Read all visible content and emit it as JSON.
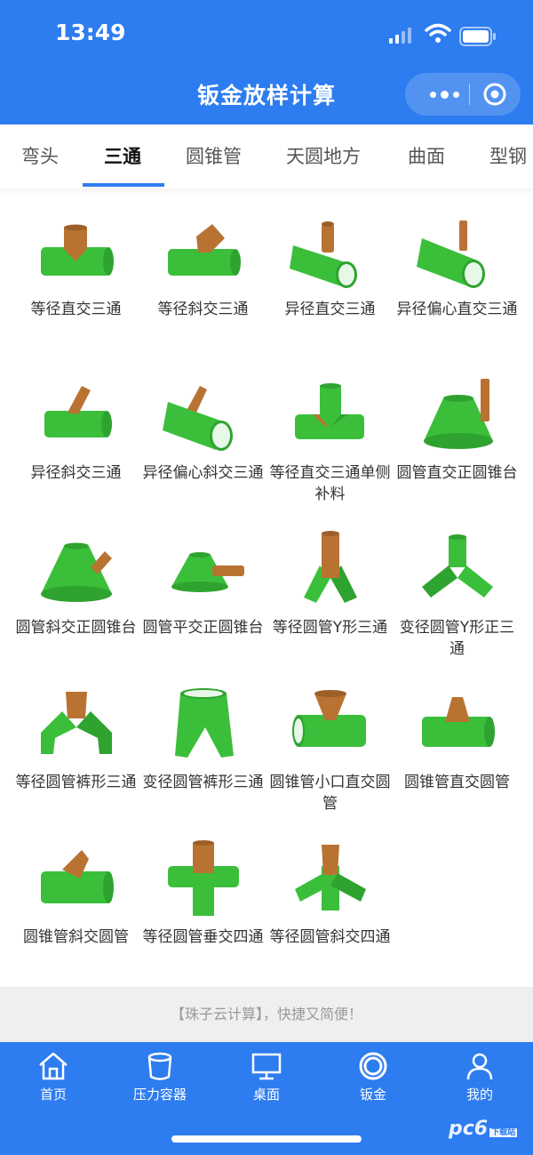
{
  "status": {
    "time": "13:49"
  },
  "header": {
    "title": "钣金放样计算",
    "more_icon": "more-dots-icon",
    "close_icon": "target-circle-icon"
  },
  "colors": {
    "brand": "#2d7cf0",
    "pipe_green": "#3bbf3b",
    "branch_brown": "#b87333"
  },
  "tabs": [
    {
      "label": "弯头",
      "active": false
    },
    {
      "label": "三通",
      "active": true
    },
    {
      "label": "圆锥管",
      "active": false
    },
    {
      "label": "天圆地方",
      "active": false
    },
    {
      "label": "曲面",
      "active": false
    },
    {
      "label": "型钢",
      "active": false
    }
  ],
  "items": [
    {
      "label": "等径直交三通"
    },
    {
      "label": "等径斜交三通"
    },
    {
      "label": "异径直交三通"
    },
    {
      "label": "异径偏心直交三通"
    },
    {
      "label": "异径斜交三通"
    },
    {
      "label": "异径偏心斜交三通"
    },
    {
      "label": "等径直交三通单侧补料"
    },
    {
      "label": "圆管直交正圆锥台"
    },
    {
      "label": "圆管斜交正圆锥台"
    },
    {
      "label": "圆管平交正圆锥台"
    },
    {
      "label": "等径圆管Y形三通"
    },
    {
      "label": "变径圆管Y形正三通"
    },
    {
      "label": "等径圆管裤形三通"
    },
    {
      "label": "变径圆管裤形三通"
    },
    {
      "label": "圆锥管小口直交圆管"
    },
    {
      "label": "圆锥管直交圆管"
    },
    {
      "label": "圆锥管斜交圆管"
    },
    {
      "label": "等径圆管垂交四通"
    },
    {
      "label": "等径圆管斜交四通"
    }
  ],
  "footer_note": "【珠子云计算】，快捷又简便！",
  "tabbar": [
    {
      "label": "首页",
      "icon": "home-icon"
    },
    {
      "label": "压力容器",
      "icon": "cylinder-icon"
    },
    {
      "label": "桌面",
      "icon": "monitor-icon"
    },
    {
      "label": "钣金",
      "icon": "ring-icon"
    },
    {
      "label": "我的",
      "icon": "user-icon"
    }
  ],
  "watermark": {
    "brand": "pc6",
    "sub": "下载站"
  }
}
